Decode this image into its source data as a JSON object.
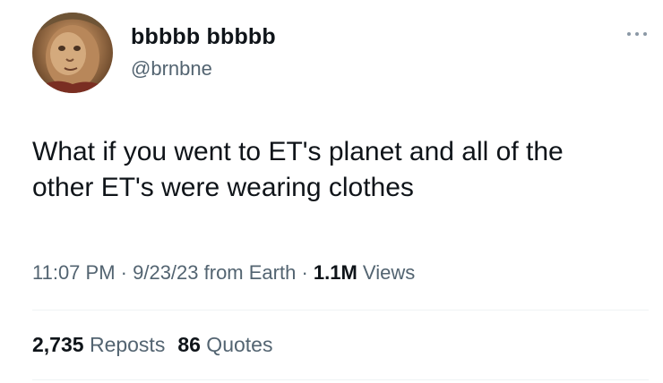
{
  "user": {
    "display_name": "bbbbb bbbbb",
    "handle": "@brnbne",
    "avatar_icon": "painted-portrait-avatar"
  },
  "more_icon": "more-horizontal-icon",
  "tweet": {
    "text_line1": "What if you went to ET's planet and all of the",
    "text_line2": "other ET's were wearing clothes"
  },
  "meta": {
    "time": "11:07 PM",
    "sep1": " · ",
    "date": "9/23/23",
    "source": " from Earth",
    "sep2": " · ",
    "views_count": "1.1M",
    "views_label": " Views"
  },
  "stats": {
    "reposts_count": "2,735",
    "reposts_label": " Reposts",
    "quotes_count": "86",
    "quotes_label": " Quotes"
  },
  "colors": {
    "text_primary": "#0f1419",
    "text_secondary": "#536471",
    "divider": "#eff3f4"
  }
}
